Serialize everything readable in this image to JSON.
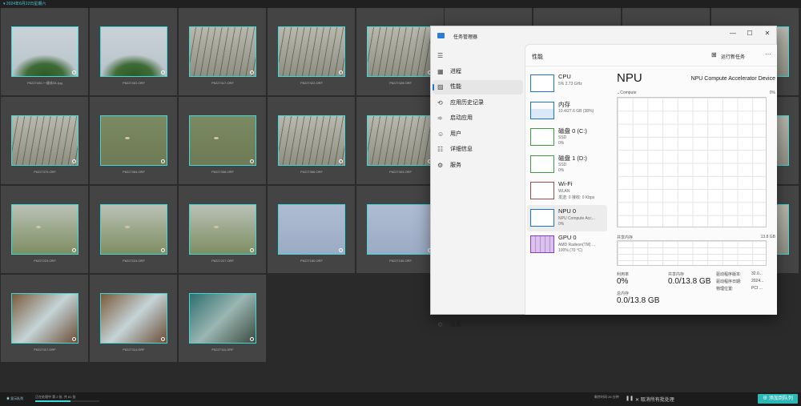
{
  "gallery": {
    "header": "2024年6月22日星期六",
    "tiles": [
      {
        "caption": "P6227430-一键成33.Jpg",
        "style": "t-sky",
        "kind": "plant"
      },
      {
        "caption": "P6227431.ORF",
        "style": "t-sky",
        "kind": "plant"
      },
      {
        "caption": "P6227417.ORF",
        "style": "t-reed",
        "kind": "reed"
      },
      {
        "caption": "P6227422.ORF",
        "style": "t-reed",
        "kind": "reed"
      },
      {
        "caption": "P6227428.ORF",
        "style": "t-reed",
        "kind": "reed"
      },
      {
        "caption": "P6227370.ORF",
        "style": "t-reed",
        "kind": "reed"
      },
      {
        "caption": "P6227364.ORF",
        "style": "t-water",
        "kind": "bird"
      },
      {
        "caption": "P6227358.ORF",
        "style": "t-water",
        "kind": "bird"
      },
      {
        "caption": "P6227366.ORF",
        "style": "t-reed",
        "kind": "reed"
      },
      {
        "caption": "P6227303.ORF",
        "style": "t-reed",
        "kind": "reed"
      },
      {
        "caption": "P6227223.ORF",
        "style": "t-pale",
        "kind": "bird"
      },
      {
        "caption": "P6227224.ORF",
        "style": "t-pale",
        "kind": "bird"
      },
      {
        "caption": "P6227227.ORF",
        "style": "t-pale",
        "kind": "bird"
      },
      {
        "caption": "P6227180.ORF",
        "style": "t-blue",
        "kind": "none"
      },
      {
        "caption": "P6227165.ORF",
        "style": "t-blue",
        "kind": "none"
      },
      {
        "caption": "P6227117.ORF",
        "style": "t-rust",
        "kind": "none"
      },
      {
        "caption": "P6227114.ORF",
        "style": "t-rust",
        "kind": "none"
      },
      {
        "caption": "P6227111.ORF",
        "style": "t-teal",
        "kind": "none"
      }
    ]
  },
  "status_bar": {
    "left_label": "显示队列",
    "progress_text": "正在处理中 第 2 张, 共 81 张",
    "progress_fraction": 0.55,
    "time_left": "剩余时间 26 分钟",
    "cancel_all": "取消所有批处理",
    "queue_button": "添加到队列"
  },
  "task_manager": {
    "title": "任务管理器",
    "controls": {
      "minimize": "—",
      "maximize": "☐",
      "close": "✕"
    },
    "nav": [
      {
        "label": "",
        "icon": "☰",
        "name": "hamburger"
      },
      {
        "label": "进程",
        "icon": "▦",
        "name": "processes"
      },
      {
        "label": "性能",
        "icon": "▨",
        "name": "performance",
        "active": true
      },
      {
        "label": "应用历史记录",
        "icon": "⟲",
        "name": "app-history"
      },
      {
        "label": "启动应用",
        "icon": "➾",
        "name": "startup"
      },
      {
        "label": "用户",
        "icon": "☺",
        "name": "users"
      },
      {
        "label": "详细信息",
        "icon": "☷",
        "name": "details"
      },
      {
        "label": "服务",
        "icon": "⚙",
        "name": "services"
      }
    ],
    "settings_label": "设置",
    "performance": {
      "title": "性能",
      "run_new_task": "运行新任务",
      "more": "···",
      "devices": [
        {
          "name": "CPU",
          "sub": "5%  2.73 GHz",
          "sub2": "",
          "color": "#1a73d0"
        },
        {
          "name": "内存",
          "sub": "10.4/27.6 GB (38%)",
          "sub2": "",
          "color": "#1a73d0"
        },
        {
          "name": "磁盘 0 (C:)",
          "sub": "SSD",
          "sub2": "0%",
          "color": "#3c9b3c"
        },
        {
          "name": "磁盘 1 (D:)",
          "sub": "SSD",
          "sub2": "0%",
          "color": "#3c9b3c"
        },
        {
          "name": "Wi-Fi",
          "sub": "WLAN",
          "sub2": "发送: 0 接收: 0 Kbps",
          "color": "#a04a4a"
        },
        {
          "name": "NPU 0",
          "sub": "NPU Compute Acc...",
          "sub2": "0%",
          "color": "#1a73d0",
          "active": true
        },
        {
          "name": "GPU 0",
          "sub": "AMD Radeon(TM) ...",
          "sub2": "100% (70 °C)",
          "color": "#8a3fb8"
        }
      ],
      "npu": {
        "heading": "NPU",
        "device_name": "NPU Compute Accelerator Device",
        "compute_label": "Compute",
        "compute_pct": "0%",
        "shared_label": "共享内存",
        "shared_max": "13.8 GB",
        "utilization_label": "利用率",
        "utilization": "0%",
        "shared_mem_label": "共享内存",
        "shared_mem": "0.0/13.8 GB",
        "total_mem_label": "总内存",
        "total_mem": "0.0/13.8 GB",
        "driver_version_label": "驱动程序版本:",
        "driver_version": "32.0...",
        "driver_date_label": "驱动程序日期:",
        "driver_date": "2024...",
        "physical_location_label": "物理位置:",
        "physical_location": "PCI ..."
      }
    }
  }
}
